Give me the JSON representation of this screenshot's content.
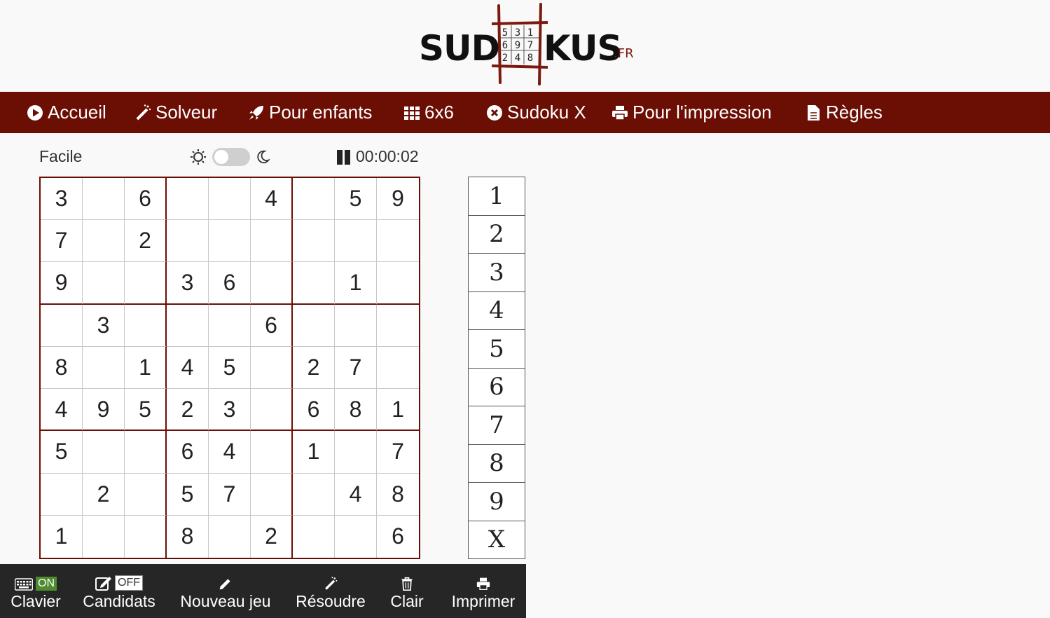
{
  "logo": {
    "word_left": "SUD",
    "word_right": "KUS",
    "suffix": ".FR",
    "digits": [
      "5",
      "3",
      "1",
      "6",
      "9",
      "7",
      "2",
      "4",
      "8"
    ],
    "accent_color": "#6b0e04"
  },
  "nav": {
    "items": [
      {
        "label": "Accueil",
        "icon": "play-circle-icon"
      },
      {
        "label": "Solveur",
        "icon": "magic-wand-icon"
      },
      {
        "label": "Pour enfants",
        "icon": "rocket-icon"
      },
      {
        "label": "6x6",
        "icon": "grid-icon"
      },
      {
        "label": "Sudoku X",
        "icon": "x-circle-icon"
      },
      {
        "label": "Pour l'impression",
        "icon": "printer-icon"
      },
      {
        "label": "Règles",
        "icon": "document-icon"
      }
    ]
  },
  "status": {
    "level": "Facile",
    "dark_mode": false,
    "timer": "00:00:02"
  },
  "board": {
    "rows": [
      [
        "3",
        "",
        "6",
        "",
        "",
        "4",
        "",
        "5",
        "9"
      ],
      [
        "7",
        "",
        "2",
        "",
        "",
        "",
        "",
        "",
        ""
      ],
      [
        "9",
        "",
        "",
        "3",
        "6",
        "",
        "",
        "1",
        ""
      ],
      [
        "",
        "3",
        "",
        "",
        "",
        "6",
        "",
        "",
        ""
      ],
      [
        "8",
        "",
        "1",
        "4",
        "5",
        "",
        "2",
        "7",
        ""
      ],
      [
        "4",
        "9",
        "5",
        "2",
        "3",
        "",
        "6",
        "8",
        "1"
      ],
      [
        "5",
        "",
        "",
        "6",
        "4",
        "",
        "1",
        "",
        "7"
      ],
      [
        "",
        "2",
        "",
        "5",
        "7",
        "",
        "",
        "4",
        "8"
      ],
      [
        "1",
        "",
        "",
        "8",
        "",
        "2",
        "",
        "",
        "6"
      ]
    ]
  },
  "picker": [
    "1",
    "2",
    "3",
    "4",
    "5",
    "6",
    "7",
    "8",
    "9",
    "X"
  ],
  "toolbar": {
    "keyboard": {
      "label": "Clavier",
      "state": "ON"
    },
    "candidates": {
      "label": "Candidats",
      "state": "OFF"
    },
    "new_game": {
      "label": "Nouveau jeu"
    },
    "solve": {
      "label": "Résoudre"
    },
    "clear": {
      "label": "Clair"
    },
    "print": {
      "label": "Imprimer"
    }
  }
}
